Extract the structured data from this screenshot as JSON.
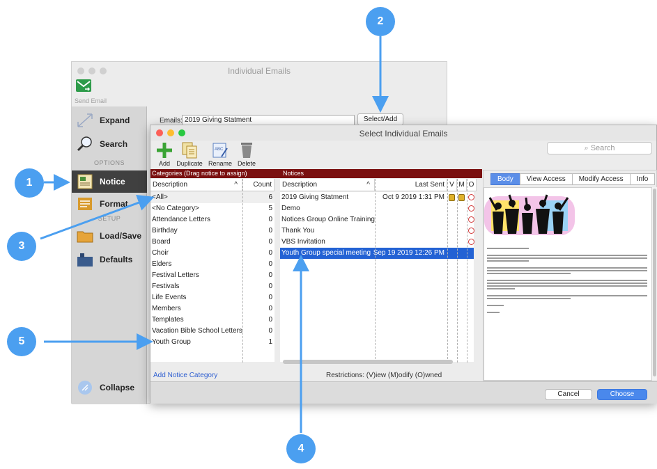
{
  "bg_window": {
    "title": "Individual Emails",
    "send_email_label": "Send Email",
    "emails_label": "Emails:",
    "emails_value": "2019 Giving Statment",
    "select_add_label": "Select/Add",
    "sidebar": {
      "expand": "Expand",
      "search": "Search",
      "options_header": "OPTIONS",
      "notice": "Notice",
      "format": "Format",
      "setup_header": "SETUP",
      "load_save": "Load/Save",
      "defaults": "Defaults",
      "collapse": "Collapse"
    }
  },
  "dialog": {
    "title": "Select Individual Emails",
    "toolbar": {
      "add": "Add",
      "duplicate": "Duplicate",
      "rename": "Rename",
      "delete": "Delete"
    },
    "search_placeholder": "Search",
    "categories_header": "Categories (Drag notice to assign)",
    "notices_header": "Notices",
    "cat_columns": {
      "description": "Description",
      "count": "Count"
    },
    "categories": [
      {
        "name": "<All>",
        "count": "6"
      },
      {
        "name": "<No Category>",
        "count": "5"
      },
      {
        "name": "Attendance Letters",
        "count": "0"
      },
      {
        "name": "Birthday",
        "count": "0"
      },
      {
        "name": "Board",
        "count": "0"
      },
      {
        "name": "Choir",
        "count": "0"
      },
      {
        "name": "Elders",
        "count": "0"
      },
      {
        "name": "Festival Letters",
        "count": "0"
      },
      {
        "name": "Festivals",
        "count": "0"
      },
      {
        "name": "Life Events",
        "count": "0"
      },
      {
        "name": "Members",
        "count": "0"
      },
      {
        "name": "Templates",
        "count": "0"
      },
      {
        "name": "Vacation Bible School Letters",
        "count": "0"
      },
      {
        "name": "Youth Group",
        "count": "1"
      }
    ],
    "notice_columns": {
      "description": "Description",
      "last_sent": "Last Sent",
      "v": "V",
      "m": "M",
      "o": "O"
    },
    "notices": [
      {
        "name": "2019 Giving Statment",
        "last_sent": "Oct 9 2019 1:31 PM"
      },
      {
        "name": "Demo",
        "last_sent": ""
      },
      {
        "name": "Notices Group Online Training",
        "last_sent": ""
      },
      {
        "name": "Thank You",
        "last_sent": ""
      },
      {
        "name": "VBS Invitation",
        "last_sent": ""
      },
      {
        "name": "Youth Group special meeting",
        "last_sent": "Sep 19 2019 12:26 PM"
      }
    ],
    "add_notice_category": "Add Notice Category",
    "restrictions": "Restrictions: (V)iew (M)odify (O)wned",
    "tabs": [
      "Body",
      "View Access",
      "Modify Access",
      "Info"
    ],
    "cancel": "Cancel",
    "choose": "Choose"
  },
  "callouts": [
    "1",
    "2",
    "3",
    "4",
    "5"
  ],
  "colors": {
    "accent": "#4b9ff0",
    "selection": "#2362d4",
    "header_red": "#7a1010"
  }
}
